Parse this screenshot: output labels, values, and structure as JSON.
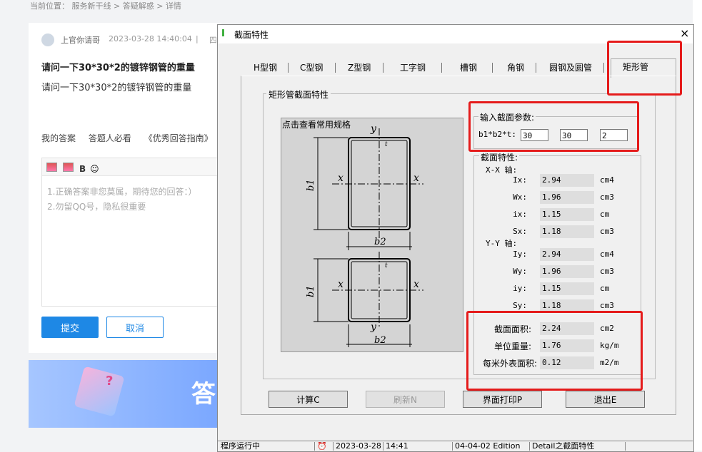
{
  "web": {
    "breadcrumb": "当前位置： 服务新干线 > 答疑解惑 > 详情",
    "username": "上官你请哥",
    "datetime": "2023-03-28 14:40:04",
    "separator": "|",
    "truncated": "四",
    "question_title": "请问一下30*30*2的镀锌钢管的重量",
    "question_body": "请问一下30*30*2的镀锌钢管的重量",
    "tabs": [
      "我的答案",
      "答题人必看",
      "《优秀回答指南》"
    ],
    "toolbar_bold": "B",
    "placeholder_1": "1.正确答案非您莫属，期待您的回答：）",
    "placeholder_2": "2.勿留QQ号，隐私很重要",
    "submit_label": "提交",
    "cancel_label": "取消",
    "banner_text": "答",
    "banner_cube_symbol": "?",
    "banner_accent": "#7aa7ff",
    "brand_blue": "#1e88e5"
  },
  "dialog": {
    "title": "截面特性",
    "icon_symbol": "I",
    "close_symbol": "×",
    "tabs": [
      "H型钢",
      "C型钢",
      "Z型钢",
      "工字钢",
      "槽钢",
      "角钢",
      "圆钢及圆管",
      "矩形管"
    ],
    "active_tab": "矩形管",
    "group_title": "矩形管截面特性",
    "drawing_label": "点击查看常用规格",
    "drawing": {
      "axis_x": "x",
      "axis_y": "y",
      "dim_b1": "b1",
      "dim_b2": "b2",
      "dim_t": "t"
    },
    "input": {
      "label": "输入截面参数:",
      "prefix": "b1*b2*t:",
      "b1": "30",
      "b2": "30",
      "t": "2"
    },
    "results": {
      "label": "截面特性:",
      "xx_axis": "X-X 轴:",
      "yy_axis": "Y-Y 轴:",
      "xx": [
        {
          "name": "Ix:",
          "value": "2.94",
          "unit": "cm4"
        },
        {
          "name": "Wx:",
          "value": "1.96",
          "unit": "cm3"
        },
        {
          "name": "ix:",
          "value": "1.15",
          "unit": "cm"
        },
        {
          "name": "Sx:",
          "value": "1.18",
          "unit": "cm3"
        }
      ],
      "yy": [
        {
          "name": "Iy:",
          "value": "2.94",
          "unit": "cm4"
        },
        {
          "name": "Wy:",
          "value": "1.96",
          "unit": "cm3"
        },
        {
          "name": "iy:",
          "value": "1.15",
          "unit": "cm"
        },
        {
          "name": "Sy:",
          "value": "1.18",
          "unit": "cm3"
        }
      ],
      "extra": [
        {
          "name": "截面面积:",
          "value": "2.24",
          "unit": "cm2"
        },
        {
          "name": "单位重量:",
          "value": "1.76",
          "unit": "kg/m"
        },
        {
          "name": "每米外表面积:",
          "value": "0.12",
          "unit": "m2/m"
        }
      ]
    },
    "buttons": {
      "calc": "计算C",
      "refresh": "刷新N",
      "print": "界面打印P",
      "exit": "退出E"
    },
    "status": [
      "程序运行中",
      "2023-03-28",
      "14:41",
      "04-04-02 Edition",
      "Detail之截面特性"
    ],
    "highlight_color": "#e51b1b"
  }
}
